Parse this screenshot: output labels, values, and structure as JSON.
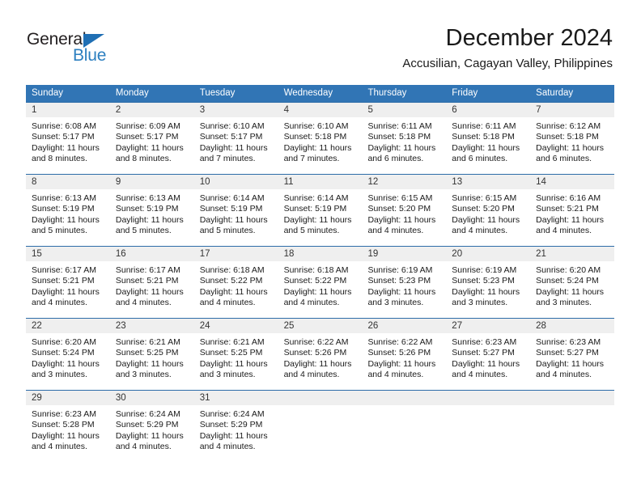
{
  "brand": {
    "name_part1": "General",
    "name_part2": "Blue",
    "triangle_color": "#1f6fb4",
    "blue_color": "#2c7fc0"
  },
  "header": {
    "title": "December 2024",
    "subtitle": "Accusilian, Cagayan Valley, Philippines"
  },
  "theme": {
    "header_blue": "#3175b5",
    "divider_blue": "#2d6ca8",
    "day_band_gray": "#efefef"
  },
  "weekdays": [
    "Sunday",
    "Monday",
    "Tuesday",
    "Wednesday",
    "Thursday",
    "Friday",
    "Saturday"
  ],
  "weeks": [
    [
      {
        "day": "1",
        "sunrise": "Sunrise: 6:08 AM",
        "sunset": "Sunset: 5:17 PM",
        "daylight1": "Daylight: 11 hours",
        "daylight2": "and 8 minutes."
      },
      {
        "day": "2",
        "sunrise": "Sunrise: 6:09 AM",
        "sunset": "Sunset: 5:17 PM",
        "daylight1": "Daylight: 11 hours",
        "daylight2": "and 8 minutes."
      },
      {
        "day": "3",
        "sunrise": "Sunrise: 6:10 AM",
        "sunset": "Sunset: 5:17 PM",
        "daylight1": "Daylight: 11 hours",
        "daylight2": "and 7 minutes."
      },
      {
        "day": "4",
        "sunrise": "Sunrise: 6:10 AM",
        "sunset": "Sunset: 5:18 PM",
        "daylight1": "Daylight: 11 hours",
        "daylight2": "and 7 minutes."
      },
      {
        "day": "5",
        "sunrise": "Sunrise: 6:11 AM",
        "sunset": "Sunset: 5:18 PM",
        "daylight1": "Daylight: 11 hours",
        "daylight2": "and 6 minutes."
      },
      {
        "day": "6",
        "sunrise": "Sunrise: 6:11 AM",
        "sunset": "Sunset: 5:18 PM",
        "daylight1": "Daylight: 11 hours",
        "daylight2": "and 6 minutes."
      },
      {
        "day": "7",
        "sunrise": "Sunrise: 6:12 AM",
        "sunset": "Sunset: 5:18 PM",
        "daylight1": "Daylight: 11 hours",
        "daylight2": "and 6 minutes."
      }
    ],
    [
      {
        "day": "8",
        "sunrise": "Sunrise: 6:13 AM",
        "sunset": "Sunset: 5:19 PM",
        "daylight1": "Daylight: 11 hours",
        "daylight2": "and 5 minutes."
      },
      {
        "day": "9",
        "sunrise": "Sunrise: 6:13 AM",
        "sunset": "Sunset: 5:19 PM",
        "daylight1": "Daylight: 11 hours",
        "daylight2": "and 5 minutes."
      },
      {
        "day": "10",
        "sunrise": "Sunrise: 6:14 AM",
        "sunset": "Sunset: 5:19 PM",
        "daylight1": "Daylight: 11 hours",
        "daylight2": "and 5 minutes."
      },
      {
        "day": "11",
        "sunrise": "Sunrise: 6:14 AM",
        "sunset": "Sunset: 5:19 PM",
        "daylight1": "Daylight: 11 hours",
        "daylight2": "and 5 minutes."
      },
      {
        "day": "12",
        "sunrise": "Sunrise: 6:15 AM",
        "sunset": "Sunset: 5:20 PM",
        "daylight1": "Daylight: 11 hours",
        "daylight2": "and 4 minutes."
      },
      {
        "day": "13",
        "sunrise": "Sunrise: 6:15 AM",
        "sunset": "Sunset: 5:20 PM",
        "daylight1": "Daylight: 11 hours",
        "daylight2": "and 4 minutes."
      },
      {
        "day": "14",
        "sunrise": "Sunrise: 6:16 AM",
        "sunset": "Sunset: 5:21 PM",
        "daylight1": "Daylight: 11 hours",
        "daylight2": "and 4 minutes."
      }
    ],
    [
      {
        "day": "15",
        "sunrise": "Sunrise: 6:17 AM",
        "sunset": "Sunset: 5:21 PM",
        "daylight1": "Daylight: 11 hours",
        "daylight2": "and 4 minutes."
      },
      {
        "day": "16",
        "sunrise": "Sunrise: 6:17 AM",
        "sunset": "Sunset: 5:21 PM",
        "daylight1": "Daylight: 11 hours",
        "daylight2": "and 4 minutes."
      },
      {
        "day": "17",
        "sunrise": "Sunrise: 6:18 AM",
        "sunset": "Sunset: 5:22 PM",
        "daylight1": "Daylight: 11 hours",
        "daylight2": "and 4 minutes."
      },
      {
        "day": "18",
        "sunrise": "Sunrise: 6:18 AM",
        "sunset": "Sunset: 5:22 PM",
        "daylight1": "Daylight: 11 hours",
        "daylight2": "and 4 minutes."
      },
      {
        "day": "19",
        "sunrise": "Sunrise: 6:19 AM",
        "sunset": "Sunset: 5:23 PM",
        "daylight1": "Daylight: 11 hours",
        "daylight2": "and 3 minutes."
      },
      {
        "day": "20",
        "sunrise": "Sunrise: 6:19 AM",
        "sunset": "Sunset: 5:23 PM",
        "daylight1": "Daylight: 11 hours",
        "daylight2": "and 3 minutes."
      },
      {
        "day": "21",
        "sunrise": "Sunrise: 6:20 AM",
        "sunset": "Sunset: 5:24 PM",
        "daylight1": "Daylight: 11 hours",
        "daylight2": "and 3 minutes."
      }
    ],
    [
      {
        "day": "22",
        "sunrise": "Sunrise: 6:20 AM",
        "sunset": "Sunset: 5:24 PM",
        "daylight1": "Daylight: 11 hours",
        "daylight2": "and 3 minutes."
      },
      {
        "day": "23",
        "sunrise": "Sunrise: 6:21 AM",
        "sunset": "Sunset: 5:25 PM",
        "daylight1": "Daylight: 11 hours",
        "daylight2": "and 3 minutes."
      },
      {
        "day": "24",
        "sunrise": "Sunrise: 6:21 AM",
        "sunset": "Sunset: 5:25 PM",
        "daylight1": "Daylight: 11 hours",
        "daylight2": "and 3 minutes."
      },
      {
        "day": "25",
        "sunrise": "Sunrise: 6:22 AM",
        "sunset": "Sunset: 5:26 PM",
        "daylight1": "Daylight: 11 hours",
        "daylight2": "and 4 minutes."
      },
      {
        "day": "26",
        "sunrise": "Sunrise: 6:22 AM",
        "sunset": "Sunset: 5:26 PM",
        "daylight1": "Daylight: 11 hours",
        "daylight2": "and 4 minutes."
      },
      {
        "day": "27",
        "sunrise": "Sunrise: 6:23 AM",
        "sunset": "Sunset: 5:27 PM",
        "daylight1": "Daylight: 11 hours",
        "daylight2": "and 4 minutes."
      },
      {
        "day": "28",
        "sunrise": "Sunrise: 6:23 AM",
        "sunset": "Sunset: 5:27 PM",
        "daylight1": "Daylight: 11 hours",
        "daylight2": "and 4 minutes."
      }
    ],
    [
      {
        "day": "29",
        "sunrise": "Sunrise: 6:23 AM",
        "sunset": "Sunset: 5:28 PM",
        "daylight1": "Daylight: 11 hours",
        "daylight2": "and 4 minutes."
      },
      {
        "day": "30",
        "sunrise": "Sunrise: 6:24 AM",
        "sunset": "Sunset: 5:29 PM",
        "daylight1": "Daylight: 11 hours",
        "daylight2": "and 4 minutes."
      },
      {
        "day": "31",
        "sunrise": "Sunrise: 6:24 AM",
        "sunset": "Sunset: 5:29 PM",
        "daylight1": "Daylight: 11 hours",
        "daylight2": "and 4 minutes."
      },
      {
        "day": "",
        "sunrise": "",
        "sunset": "",
        "daylight1": "",
        "daylight2": ""
      },
      {
        "day": "",
        "sunrise": "",
        "sunset": "",
        "daylight1": "",
        "daylight2": ""
      },
      {
        "day": "",
        "sunrise": "",
        "sunset": "",
        "daylight1": "",
        "daylight2": ""
      },
      {
        "day": "",
        "sunrise": "",
        "sunset": "",
        "daylight1": "",
        "daylight2": ""
      }
    ]
  ]
}
